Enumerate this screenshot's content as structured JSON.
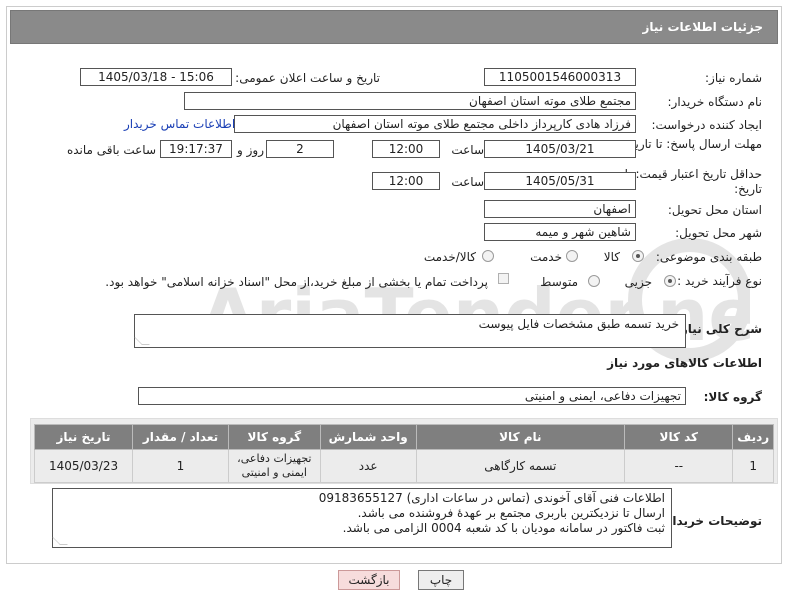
{
  "header": {
    "title": "جزئیات اطلاعات نیاز"
  },
  "fields": {
    "need_number_label": "شماره نیاز:",
    "need_number": "1105001546000313",
    "announce_label": "تاریخ و ساعت اعلان عمومی:",
    "announce_value": "1405/03/18 - 15:06",
    "buyer_org_label": "نام دستگاه خریدار:",
    "buyer_org": "مجتمع طلای موته استان اصفهان",
    "creator_label": "ایجاد کننده درخواست:",
    "creator": "فرزاد هادی کارپرداز داخلی مجتمع طلای موته استان اصفهان",
    "contact_link": "اطلاعات تماس خریدار",
    "reply_deadline_label": "مهلت ارسال پاسخ: تا تاریخ:",
    "reply_date": "1405/03/21",
    "time_label": "ساعت",
    "reply_time": "12:00",
    "days_value": "2",
    "days_label": "روز و",
    "remaining_time": "19:17:37",
    "remaining_label": "ساعت باقی مانده",
    "price_validity_label": "حداقل تاریخ اعتبار قیمت: تا تاریخ:",
    "price_date": "1405/05/31",
    "price_time": "12:00",
    "province_label": "استان محل تحویل:",
    "province": "اصفهان",
    "city_label": "شهر محل تحویل:",
    "city": "شاهین شهر و میمه",
    "category_label": "طبقه بندی موضوعی:",
    "category_options": [
      "کالا",
      "خدمت",
      "کالا/خدمت"
    ],
    "process_label": "نوع فرآیند خرید :",
    "process_options": [
      "جزیی",
      "متوسط"
    ],
    "payment_note": "پرداخت تمام یا بخشی از مبلغ خرید،از محل \"اسناد خزانه اسلامی\" خواهد بود.",
    "description_label": "شرح کلی نیاز:",
    "description": "خرید تسمه طبق مشخصات فایل پیوست",
    "goods_info_title": "اطلاعات کالاهای مورد نیاز",
    "goods_group_label": "گروه کالا:",
    "goods_group": "تجهیزات دفاعی، ایمنی و امنیتی"
  },
  "table": {
    "headers": [
      "ردیف",
      "کد کالا",
      "نام کالا",
      "واحد شمارش",
      "گروه کالا",
      "تعداد / مقدار",
      "تاریخ نیاز"
    ],
    "rows": [
      [
        "1",
        "--",
        "تسمه کارگاهی",
        "عدد",
        "تجهیزات دفاعی، ایمنی و امنیتی",
        "1",
        "1405/03/23"
      ]
    ]
  },
  "buyer_notes": {
    "label": "توضیحات خریدار:",
    "lines": [
      "اطلاعات فنی آقای آخوندی (تماس در ساعات اداری) 09183655127",
      "ارسال تا نزدیکترین باربری مجتمع بر عهدۀ فروشنده می باشد.",
      "ثبت فاکتور در سامانه مودیان با کد شعبه 0004 الزامی می باشد."
    ]
  },
  "buttons": {
    "print": "چاپ",
    "back": "بازگشت"
  },
  "watermark": {
    "text": "AriaTender.net"
  },
  "colors": {
    "header_bg": "#8a8a8a",
    "link": "#1a3fb5",
    "back_button_bg": "#f7dcdc"
  }
}
